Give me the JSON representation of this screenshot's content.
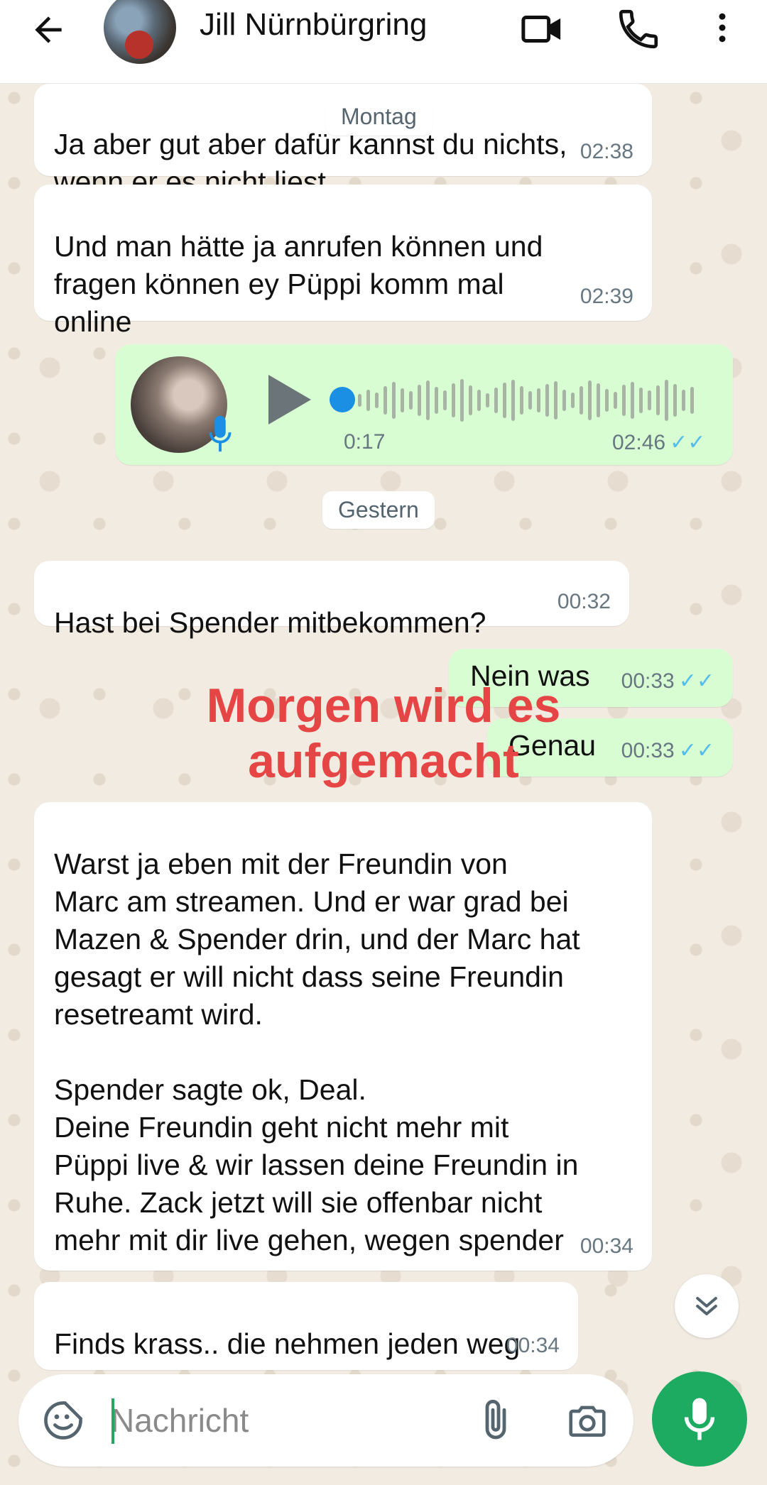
{
  "header": {
    "contact_name": "Jill Nürnbürgring",
    "icons": [
      "back-arrow-icon",
      "video-call-icon",
      "phone-icon",
      "more-vert-icon"
    ]
  },
  "day_chips": {
    "monday": "Montag",
    "yesterday": "Gestern"
  },
  "messages": [
    {
      "type": "in",
      "text": "Ja aber gut aber dafür kannst du nichts,\nwenn er es nicht liest…",
      "time": "02:38"
    },
    {
      "type": "in",
      "text": "Und man hätte ja anrufen können und\nfragen können ey Püppi komm mal\nonline",
      "time": "02:39"
    },
    {
      "type": "out-voice",
      "duration": "0:17",
      "time": "02:46",
      "status": "read"
    },
    {
      "type": "in",
      "text": "Hast bei Spender mitbekommen?",
      "time": "00:32"
    },
    {
      "type": "out",
      "text": "Nein was",
      "time": "00:33",
      "status": "read"
    },
    {
      "type": "out",
      "text": "Genau",
      "time": "00:33",
      "status": "read"
    },
    {
      "type": "in",
      "text": "Warst ja eben mit der Freundin von\nMarc am streamen. Und er war grad bei\nMazen & Spender drin, und der Marc hat\ngesagt er will nicht dass seine Freundin\nresetreamt wird.\n\nSpender sagte ok, Deal.\nDeine Freundin geht nicht mehr mit\nPüppi live & wir lassen deine Freundin in\nRuhe. Zack jetzt will sie offenbar nicht\nmehr mit dir live gehen, wegen spender",
      "time": "00:34"
    },
    {
      "type": "in",
      "text": "Finds krass.. die nehmen jeden weg",
      "time": "00:34"
    }
  ],
  "overlay": {
    "text": "Morgen wird es\naufgemacht",
    "color": "#e64545"
  },
  "read_ticks": "✓✓",
  "composer": {
    "placeholder": "Nachricht",
    "icons": [
      "emoji-sticker-icon",
      "attach-icon",
      "camera-icon",
      "mic-icon"
    ]
  },
  "colors": {
    "accent": "#1daa61",
    "outgoing": "#d9fdd3",
    "incoming": "#ffffff",
    "tick": "#53bdeb"
  }
}
